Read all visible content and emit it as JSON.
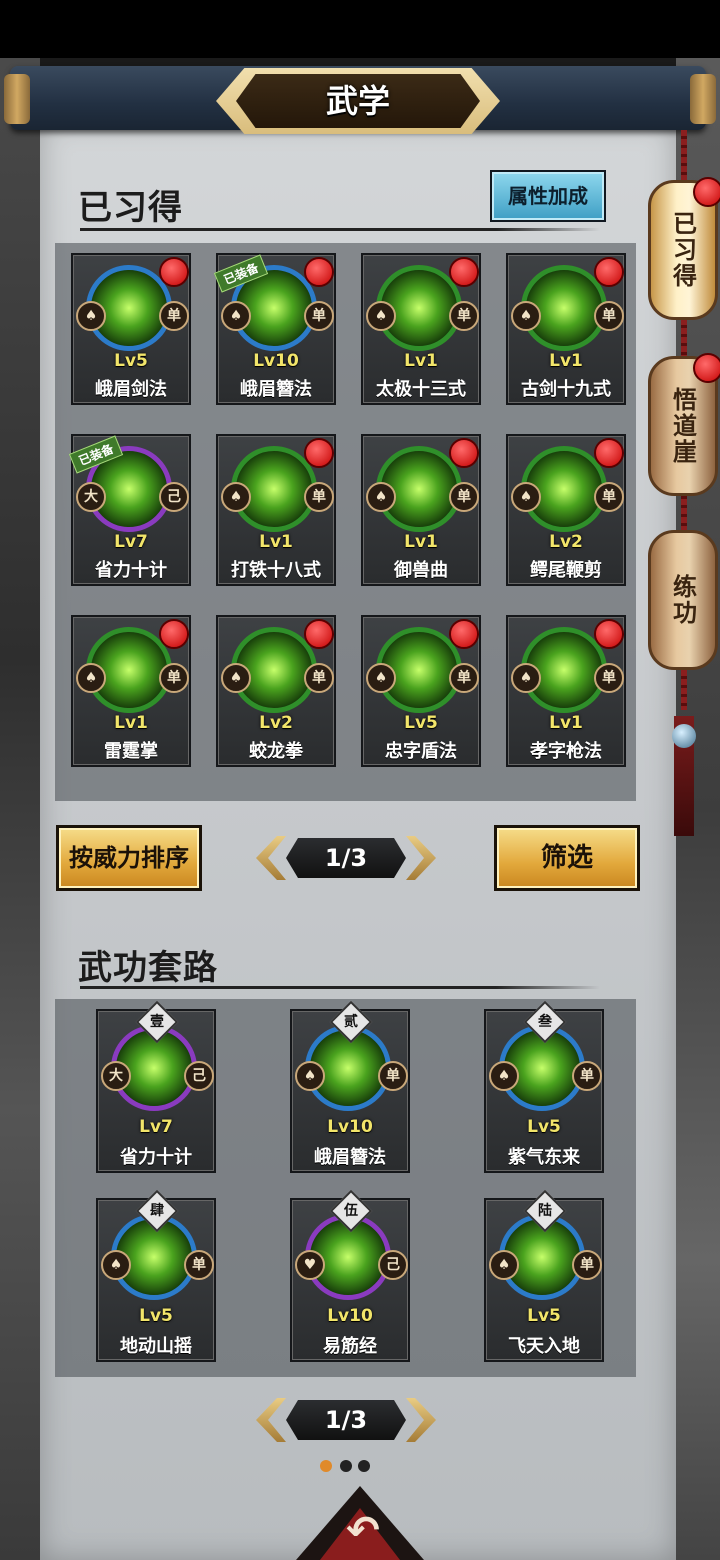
{
  "title": "武学",
  "learned": {
    "heading": "已习得",
    "attr_button": "属性加成",
    "cards": [
      {
        "lv": "Lv5",
        "name": "峨眉剑法",
        "left": "♠",
        "right": "单",
        "dot": true,
        "equipped": "",
        "ring": "blue"
      },
      {
        "lv": "Lv10",
        "name": "峨眉簪法",
        "left": "♠",
        "right": "单",
        "dot": true,
        "equipped": "已装备",
        "ring": "blue"
      },
      {
        "lv": "Lv1",
        "name": "太极十三式",
        "left": "♠",
        "right": "单",
        "dot": true,
        "equipped": "",
        "ring": "green"
      },
      {
        "lv": "Lv1",
        "name": "古剑十九式",
        "left": "♠",
        "right": "单",
        "dot": true,
        "equipped": "",
        "ring": "green"
      },
      {
        "lv": "Lv7",
        "name": "省力十计",
        "left": "大",
        "right": "己",
        "dot": false,
        "equipped": "已装备",
        "ring": "purple"
      },
      {
        "lv": "Lv1",
        "name": "打铁十八式",
        "left": "♠",
        "right": "单",
        "dot": true,
        "equipped": "",
        "ring": "green"
      },
      {
        "lv": "Lv1",
        "name": "御兽曲",
        "left": "♠",
        "right": "单",
        "dot": true,
        "equipped": "",
        "ring": "green"
      },
      {
        "lv": "Lv2",
        "name": "鳄尾鞭剪",
        "left": "♠",
        "right": "单",
        "dot": true,
        "equipped": "",
        "ring": "green"
      },
      {
        "lv": "Lv1",
        "name": "雷霆掌",
        "left": "♠",
        "right": "单",
        "dot": true,
        "equipped": "",
        "ring": "green"
      },
      {
        "lv": "Lv2",
        "name": "蛟龙拳",
        "left": "♠",
        "right": "单",
        "dot": true,
        "equipped": "",
        "ring": "green"
      },
      {
        "lv": "Lv5",
        "name": "忠字盾法",
        "left": "♠",
        "right": "单",
        "dot": true,
        "equipped": "",
        "ring": "green"
      },
      {
        "lv": "Lv1",
        "name": "孝字枪法",
        "left": "♠",
        "right": "单",
        "dot": true,
        "equipped": "",
        "ring": "green"
      }
    ]
  },
  "sort_button": "按威力排序",
  "filter_button": "筛选",
  "pager_top": "1/3",
  "routines": {
    "heading": "武功套路",
    "cards": [
      {
        "rank": "壹",
        "lv": "Lv7",
        "name": "省力十计",
        "left": "大",
        "right": "己",
        "ring": "purple"
      },
      {
        "rank": "贰",
        "lv": "Lv10",
        "name": "峨眉簪法",
        "left": "♠",
        "right": "单",
        "ring": "blue"
      },
      {
        "rank": "叁",
        "lv": "Lv5",
        "name": "紫气东来",
        "left": "♠",
        "right": "单",
        "ring": "blue"
      },
      {
        "rank": "肆",
        "lv": "Lv5",
        "name": "地动山摇",
        "left": "♠",
        "right": "单",
        "ring": "blue"
      },
      {
        "rank": "伍",
        "lv": "Lv10",
        "name": "易筋经",
        "left": "♥",
        "right": "己",
        "ring": "purple"
      },
      {
        "rank": "陆",
        "lv": "Lv5",
        "name": "飞天入地",
        "left": "♠",
        "right": "单",
        "ring": "blue"
      }
    ]
  },
  "pager_bottom": "1/3",
  "side_tabs": [
    {
      "label": "已习得",
      "active": true,
      "dot": true
    },
    {
      "label": "悟道崖",
      "active": false,
      "dot": true
    },
    {
      "label": "练功",
      "active": false,
      "dot": false
    }
  ],
  "colors": {
    "accent_gold": "#e2a83b",
    "red_dot": "#c40000",
    "attr_blue": "#3d9ec4"
  }
}
